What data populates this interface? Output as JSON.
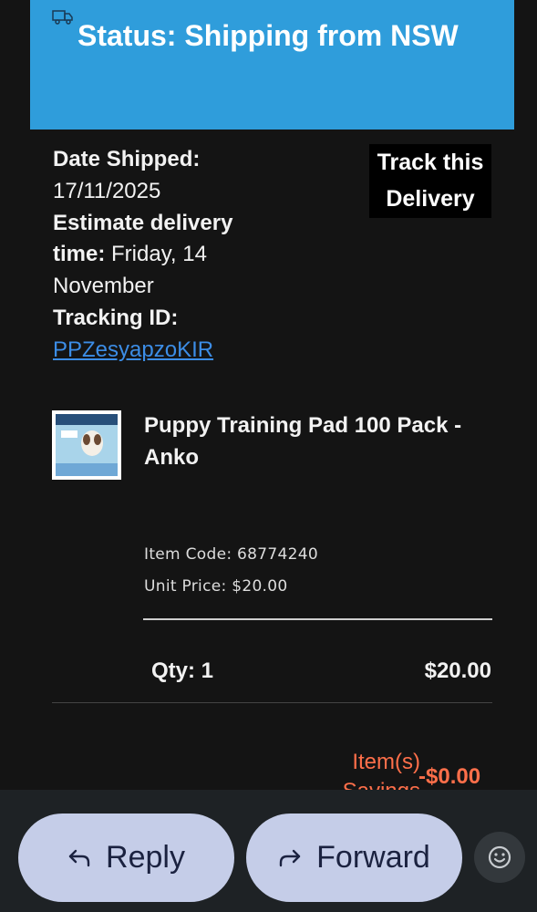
{
  "status": {
    "title": "Status: Shipping from NSW",
    "icon": "truck-icon"
  },
  "shipment": {
    "date_shipped_label": "Date Shipped:",
    "date_shipped": "17/11/2025",
    "estimate_label": "Estimate delivery time:",
    "estimate_value": "Friday, 14 November",
    "tracking_label": "Tracking ID:",
    "tracking_id": "PPZesyapzoKIR",
    "track_button": "Track this Delivery"
  },
  "item": {
    "name": "Puppy Training Pad 100 Pack - Anko",
    "code_line": "Item Code: 68774240",
    "price_line": "Unit Price: $20.00",
    "qty_line": "Qty: 1",
    "line_total": "$20.00"
  },
  "summary": {
    "savings_label": "Item(s) Savings",
    "savings_value": "-$0.00"
  },
  "actions": {
    "reply_label": "Reply",
    "forward_label": "Forward"
  },
  "colors": {
    "banner": "#2f9ddb",
    "savings": "#ff6f4a",
    "link": "#3c8de6",
    "pill": "#c5cde8"
  }
}
